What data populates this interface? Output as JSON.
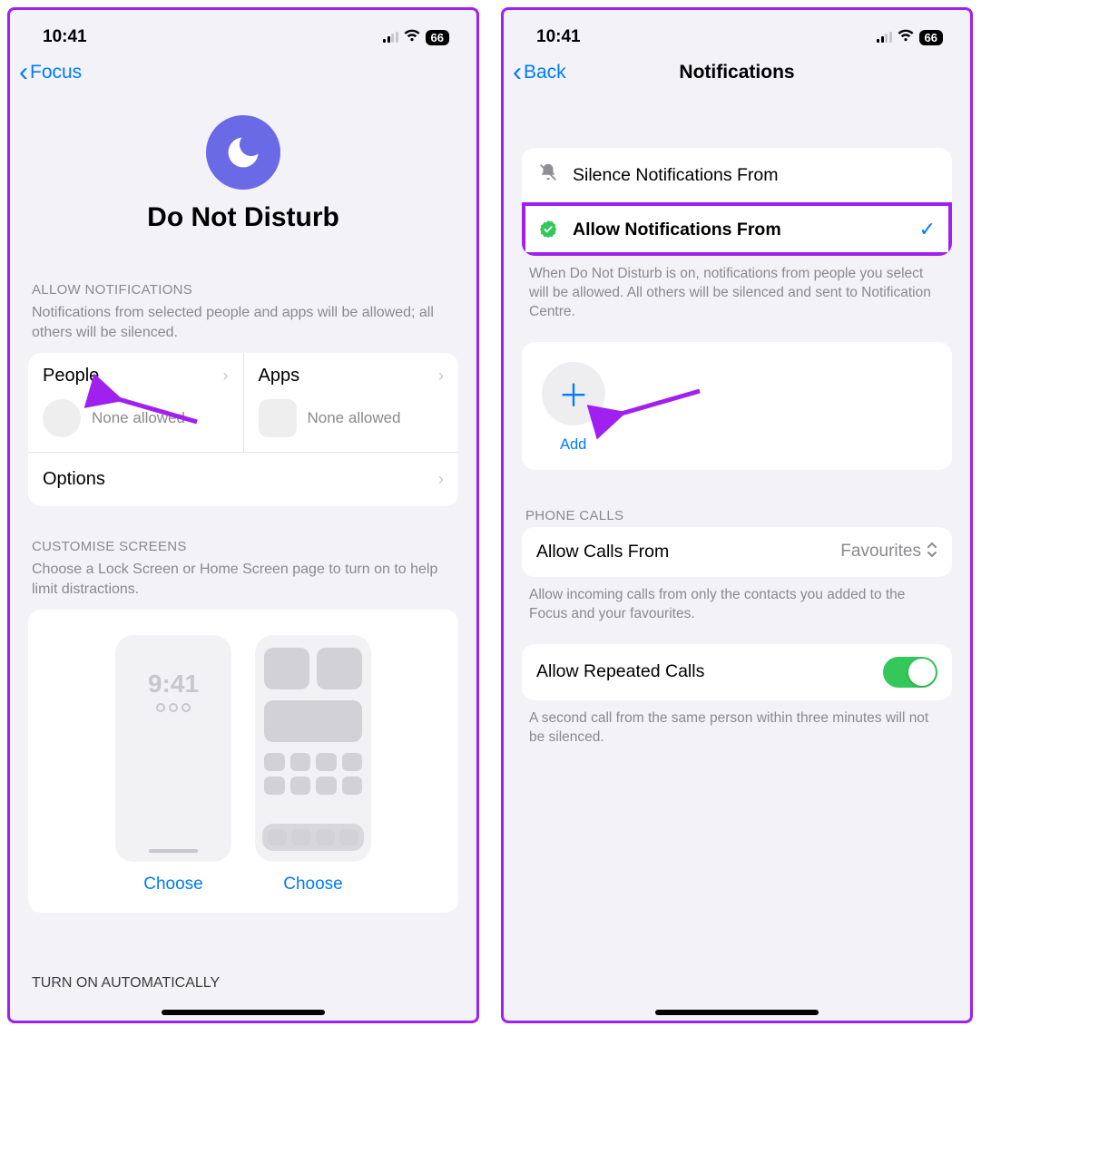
{
  "status": {
    "time": "10:41",
    "battery": "66"
  },
  "left": {
    "back_label": "Focus",
    "hero_title": "Do Not Disturb",
    "allow_header": "ALLOW NOTIFICATIONS",
    "allow_desc": "Notifications from selected people and apps will be allowed; all others will be silenced.",
    "people_label": "People",
    "apps_label": "Apps",
    "none_allowed": "None allowed",
    "options_label": "Options",
    "customise_header": "CUSTOMISE SCREENS",
    "customise_desc": "Choose a Lock Screen or Home Screen page to turn on to help limit distractions.",
    "mock_time": "9:41",
    "choose_label": "Choose",
    "auto_header": "TURN ON AUTOMATICALLY"
  },
  "right": {
    "back_label": "Back",
    "title": "Notifications",
    "silence_label": "Silence Notifications From",
    "allow_label": "Allow Notifications From",
    "selection_desc": "When Do Not Disturb is on, notifications from people you select will be allowed. All others will be silenced and sent to Notification Centre.",
    "add_label": "Add",
    "phone_calls_header": "PHONE CALLS",
    "allow_calls_label": "Allow Calls From",
    "allow_calls_value": "Favourites",
    "calls_desc": "Allow incoming calls from only the contacts you added to the Focus and your favourites.",
    "repeated_label": "Allow Repeated Calls",
    "repeated_desc": "A second call from the same person within three minutes will not be silenced."
  }
}
